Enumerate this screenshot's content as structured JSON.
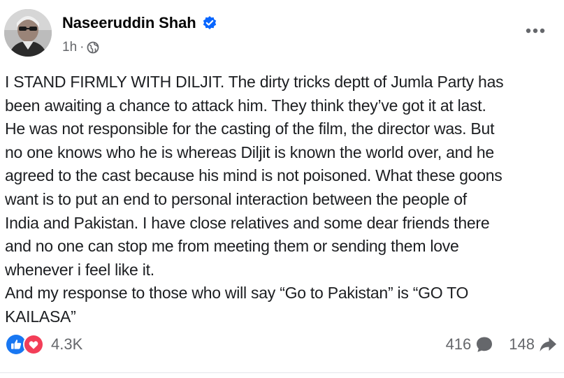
{
  "post": {
    "author": "Naseeruddin Shah",
    "verified": true,
    "timestamp": "1h",
    "separator": "·",
    "audience_icon": "globe-icon",
    "lines": [
      "I STAND FIRMLY WITH DILJIT. The dirty tricks deptt of Jumla Party has",
      "been awaiting a chance to attack him. They think they’ve got it at last.",
      "He was not responsible for the casting of the film, the director was. But",
      "no one knows who he is whereas Diljit is known the world over, and he",
      "agreed to the cast because his mind is not poisoned. What these goons",
      "want is to put an end to personal interaction between the people of",
      "India and Pakistan. I have close relatives and some dear friends there",
      "and no one can stop me from meeting them or sending them love",
      "whenever i feel like it.",
      "And my response to  those who will say “Go to Pakistan” is “GO TO",
      "KAILASA”"
    ]
  },
  "reactions": {
    "icons": [
      "like-icon",
      "love-icon"
    ],
    "count": "4.3K"
  },
  "stats": {
    "comments": "416",
    "comment_icon": "comment-icon",
    "shares": "148",
    "share_icon": "share-icon"
  },
  "colors": {
    "verified_blue": "#0866ff",
    "like_blue": "#1877f2",
    "love_red": "#f33e58",
    "meta_gray": "#65676b"
  }
}
